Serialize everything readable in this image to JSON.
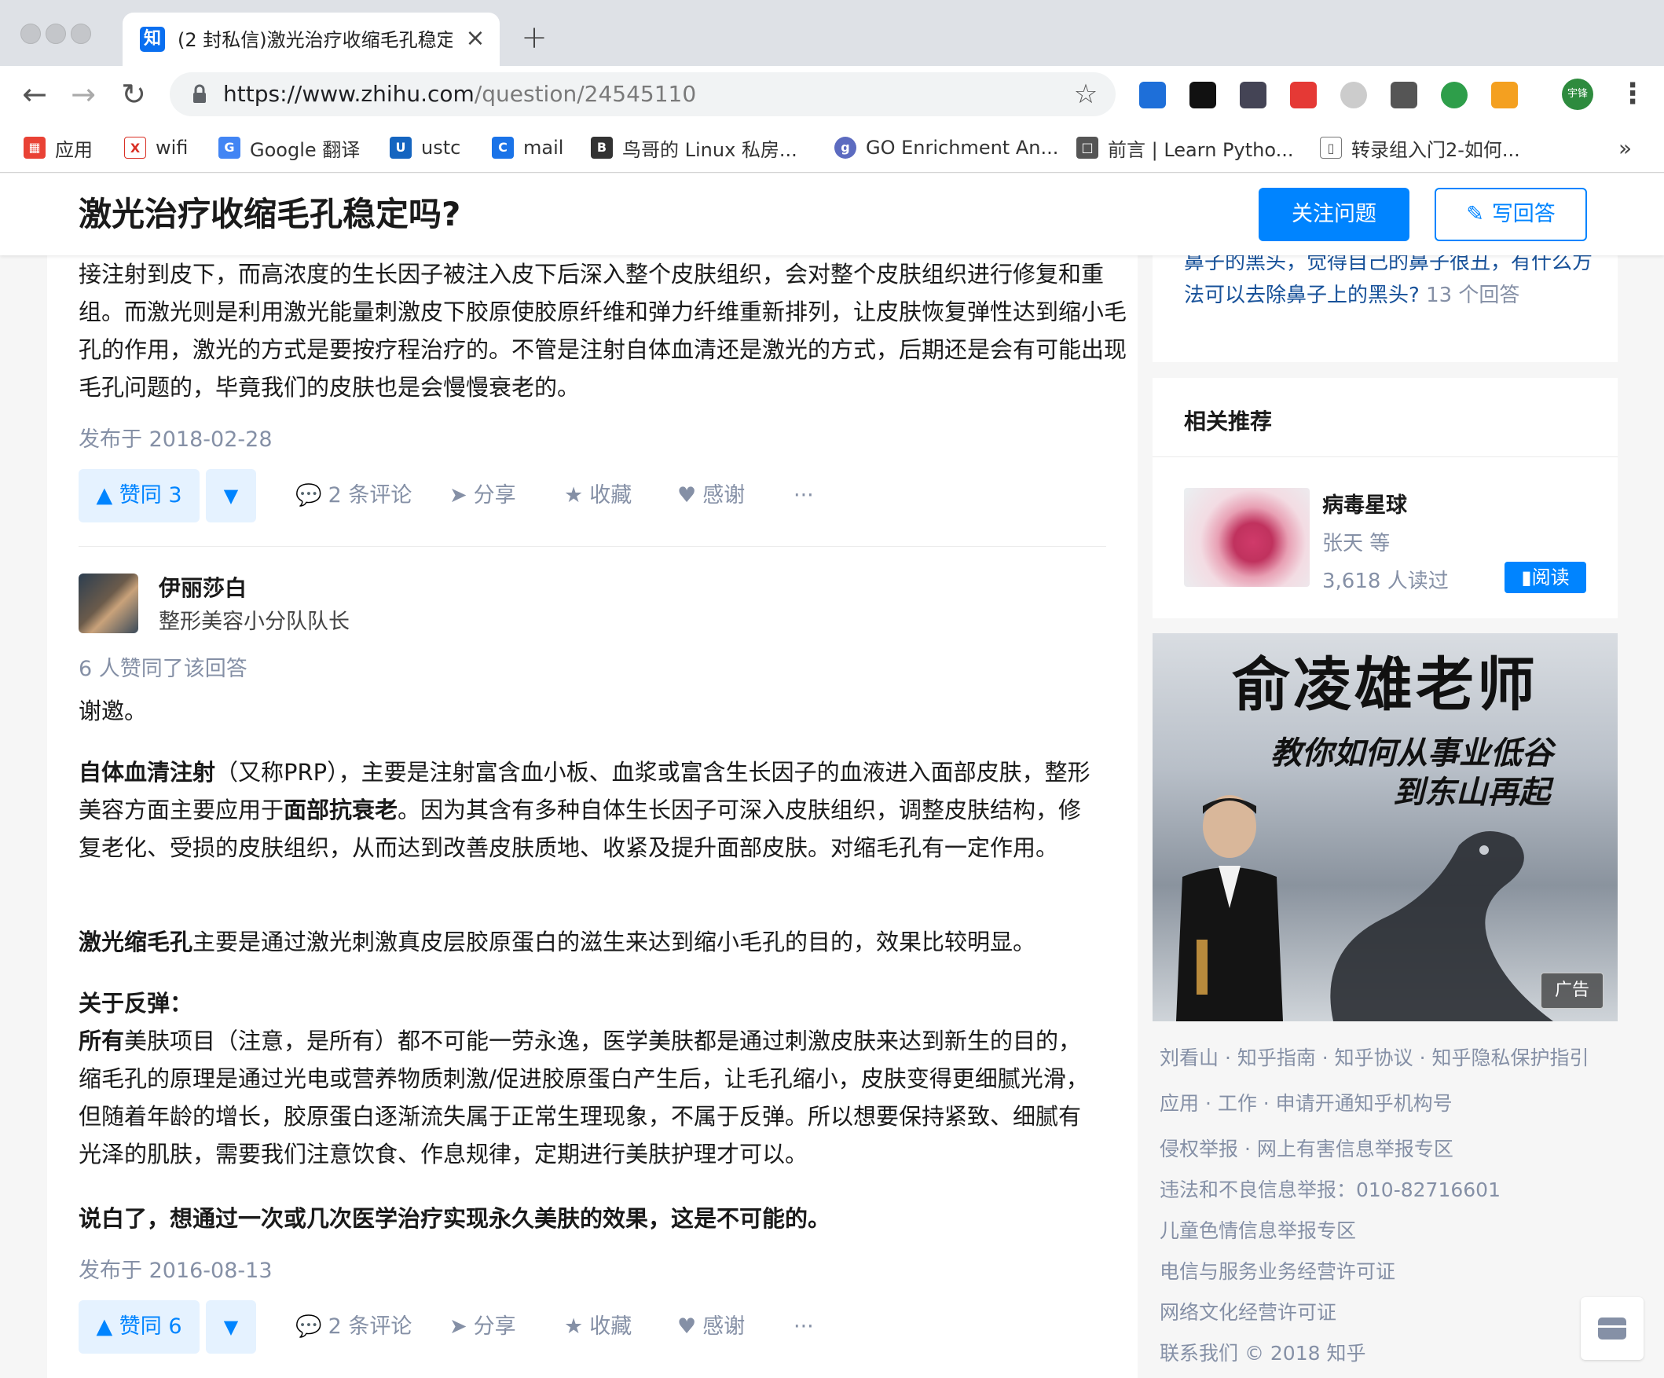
{
  "browser": {
    "tab_title": "(2 封私信)激光治疗收缩毛孔稳定",
    "tab_favicon": "知",
    "url_host": "https://www.zhihu.com",
    "url_path": "/question/24545110",
    "avatar_text": "宇锋",
    "bookmarks": [
      {
        "label": "应用",
        "icon": "apps-grid-icon",
        "color": "#e94235"
      },
      {
        "label": "wifi",
        "icon": "wifi-bookmark-icon",
        "color": "#d93025"
      },
      {
        "label": "Google 翻译",
        "icon": "google-translate-icon",
        "color": "#4285f4"
      },
      {
        "label": "ustc",
        "icon": "ustc-icon",
        "color": "#1565c0"
      },
      {
        "label": "mail",
        "icon": "mail-icon",
        "color": "#1a73e8"
      },
      {
        "label": "鸟哥的 Linux 私房...",
        "icon": "vbird-icon",
        "color": "#333333"
      },
      {
        "label": "GO Enrichment An...",
        "icon": "go-icon",
        "color": "#5c6bc0"
      },
      {
        "label": "前言 | Learn Pytho...",
        "icon": "book-icon",
        "color": "#555555"
      },
      {
        "label": "转录组入门2-如何...",
        "icon": "page-icon",
        "color": "#777777"
      }
    ],
    "bookmarks_more": "»"
  },
  "question": {
    "title": "激光治疗收缩毛孔稳定吗?",
    "follow_label": "关注问题",
    "write_label": "写回答"
  },
  "answer1": {
    "paragraph": "接注射到皮下，而高浓度的生长因子被注入皮下后深入整个皮肤组织，会对整个皮肤组织进行修复和重组。而激光则是利用激光能量刺激皮下胶原使胶原纤维和弹力纤维重新排列，让皮肤恢复弹性达到缩小毛孔的作用，激光的方式是要按疗程治疗的。不管是注射自体血清还是激光的方式，后期还是会有可能出现毛孔问题的，毕竟我们的皮肤也是会慢慢衰老的。",
    "published": "发布于 2018-02-28",
    "vote_label": "▲ 赞同 3",
    "comments": "2 条评论",
    "share": "分享",
    "collect": "收藏",
    "thanks": "感谢",
    "more": "···"
  },
  "answer2": {
    "author_name": "伊丽莎白",
    "author_bio": "整形美容小分队队长",
    "voters": "6 人赞同了该回答",
    "p1": "谢邀。",
    "p2_bold1": "自体血清注射",
    "p2_text1": "（又称PRP），主要是注射富含血小板、血浆或富含生长因子的血液进入面部皮肤，整形美容方面主要应用于",
    "p2_bold2": "面部抗衰老",
    "p2_text2": "。因为其含有多种自体生长因子可深入皮肤组织，调整皮肤结构，修复老化、受损的皮肤组织，从而达到改善皮肤质地、收紧及提升面部皮肤。对缩毛孔有一定作用。",
    "p3_bold": "激光缩毛孔",
    "p3_text": "主要是通过激光刺激真皮层胶原蛋白的滋生来达到缩小毛孔的目的，效果比较明显。",
    "p4_heading": "关于反弹：",
    "p4_bold": "所有",
    "p4_text": "美肤项目（注意，是所有）都不可能一劳永逸，医学美肤都是通过刺激皮肤来达到新生的目的，缩毛孔的原理是通过光电或营养物质刺激/促进胶原蛋白产生后，让毛孔缩小，皮肤变得更细腻光滑，但随着年龄的增长，胶原蛋白逐渐流失属于正常生理现象，不属于反弹。所以想要保持紧致、细腻有光泽的肌肤，需要我们注意饮食、作息规律，定期进行美肤护理才可以。",
    "p5_bold": "说白了，想通过一次或几次医学治疗实现永久美肤的效果，这是不可能的。",
    "published": "发布于 2016-08-13",
    "vote_label": "▲ 赞同 6",
    "comments": "2 条评论",
    "share": "分享",
    "collect": "收藏",
    "thanks": "感谢",
    "more": "···"
  },
  "sidebar": {
    "related_question_partial": "鼻子的黑头，觉得自己的鼻子很丑，有什么方法可以去除鼻子上的黑头?",
    "related_question_count": "13 个回答",
    "rec_title": "相关推荐",
    "rec_book": "病毒星球",
    "rec_author": "张天 等",
    "rec_readers": "3,618 人读过",
    "rec_read_label": "阅读",
    "ad_heading": "俞凌雄老师",
    "ad_sub1": "教你如何从事业低谷",
    "ad_sub2": "到东山再起",
    "ad_badge": "广告"
  },
  "footer": {
    "line1": "刘看山 · 知乎指南 · 知乎协议 · 知乎隐私保护指引",
    "line2": "应用 · 工作 · 申请开通知乎机构号",
    "line3": "侵权举报 · 网上有害信息举报专区",
    "line4": "违法和不良信息举报：010-82716601",
    "line5": "儿童色情信息举报专区",
    "line6": "电信与服务业务经营许可证",
    "line7": "网络文化经营许可证",
    "line8": "联系我们 © 2018 知乎"
  }
}
